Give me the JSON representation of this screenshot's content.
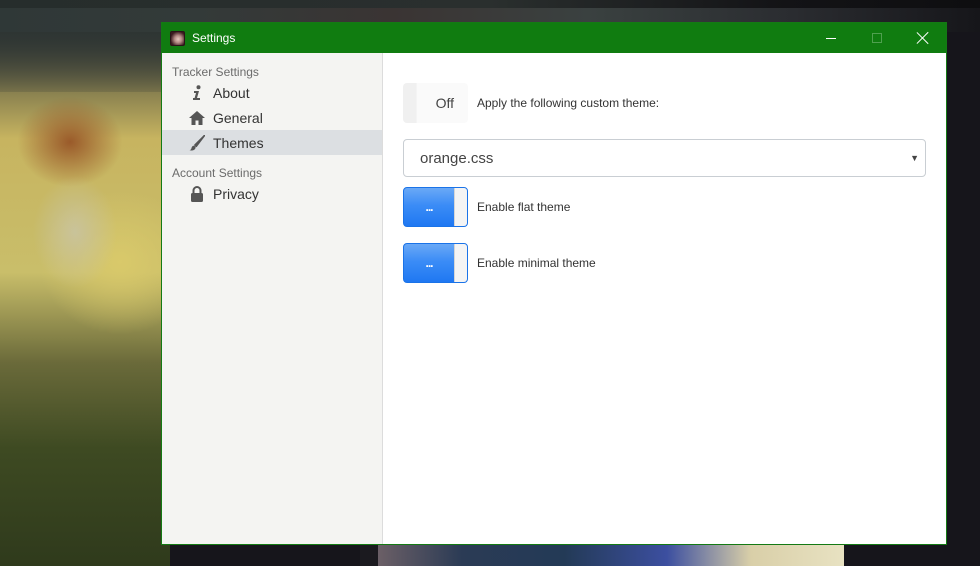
{
  "window": {
    "title": "Settings",
    "icon": "app-avatar-icon",
    "controls": {
      "minimize": "minimize-icon",
      "maximize": "maximize-icon",
      "close": "close-icon"
    },
    "accent_color": "#107c10"
  },
  "sidebar": {
    "sections": [
      {
        "header": "Tracker Settings",
        "items": [
          {
            "label": "About",
            "icon": "info-icon",
            "active": false
          },
          {
            "label": "General",
            "icon": "home-icon",
            "active": false
          },
          {
            "label": "Themes",
            "icon": "brush-icon",
            "active": true
          }
        ]
      },
      {
        "header": "Account Settings",
        "items": [
          {
            "label": "Privacy",
            "icon": "lock-icon",
            "active": false
          }
        ]
      }
    ]
  },
  "themes": {
    "custom_theme": {
      "toggle_state": "Off",
      "label": "Apply the following custom theme:"
    },
    "theme_select": {
      "value": "orange.css",
      "arrow": "▼"
    },
    "flat_theme": {
      "toggle_text": "...",
      "label": "Enable flat theme"
    },
    "minimal_theme": {
      "toggle_text": "...",
      "label": "Enable minimal theme"
    },
    "toggle_on_color": "#1f78f2"
  }
}
